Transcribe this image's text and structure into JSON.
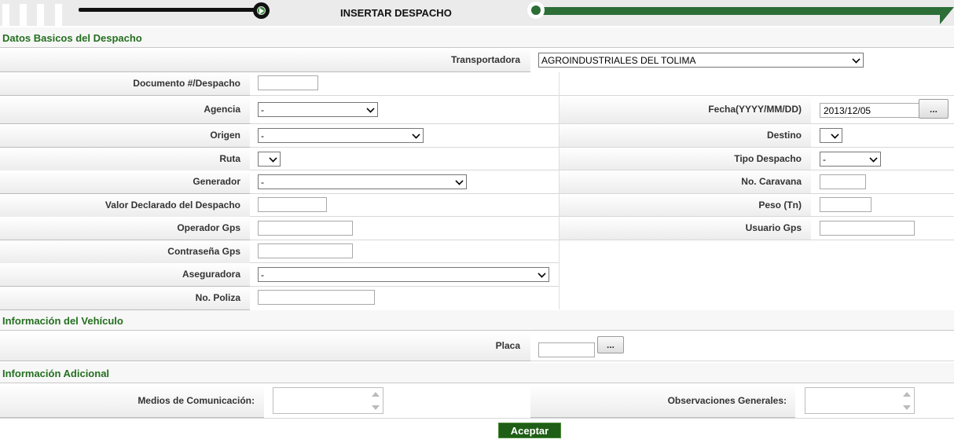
{
  "header": {
    "title": "INSERTAR DESPACHO",
    "accent": "#2c6e36"
  },
  "sections": {
    "basic": "Datos Basicos del Despacho",
    "vehicle": "Información del Vehículo",
    "additional": "Información Adicional"
  },
  "fields": {
    "transportadora": {
      "label": "Transportadora",
      "value": "AGROINDUSTRIALES DEL TOLIMA"
    },
    "documento": {
      "label": "Documento #/Despacho",
      "value": ""
    },
    "agencia": {
      "label": "Agencia",
      "value": "-"
    },
    "fecha": {
      "label": "Fecha(YYYY/MM/DD)",
      "value": "2013/12/05",
      "button": "..."
    },
    "origen": {
      "label": "Origen",
      "value": "-"
    },
    "destino": {
      "label": "Destino",
      "value": ""
    },
    "ruta": {
      "label": "Ruta",
      "value": ""
    },
    "tipo_despacho": {
      "label": "Tipo Despacho",
      "value": "-"
    },
    "generador": {
      "label": "Generador",
      "value": "-"
    },
    "no_caravana": {
      "label": "No. Caravana",
      "value": ""
    },
    "valor_declarado": {
      "label": "Valor Declarado del Despacho",
      "value": ""
    },
    "peso": {
      "label": "Peso (Tn)",
      "value": ""
    },
    "operador_gps": {
      "label": "Operador Gps",
      "value": ""
    },
    "usuario_gps": {
      "label": "Usuario Gps",
      "value": ""
    },
    "contrasena_gps": {
      "label": "Contraseña Gps",
      "value": ""
    },
    "aseguradora": {
      "label": "Aseguradora",
      "value": "-"
    },
    "no_poliza": {
      "label": "No. Poliza",
      "value": ""
    },
    "placa": {
      "label": "Placa",
      "value": "",
      "button": "..."
    },
    "medios_comunicacion": {
      "label": "Medios de Comunicación:",
      "value": ""
    },
    "observaciones": {
      "label": "Observaciones Generales:",
      "value": ""
    }
  },
  "actions": {
    "accept": "Aceptar"
  }
}
